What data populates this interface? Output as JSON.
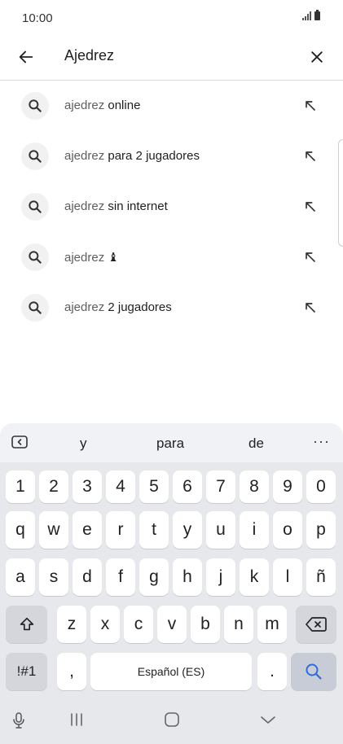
{
  "status": {
    "time": "10:00"
  },
  "search": {
    "query": "Ajedrez"
  },
  "suggestions": [
    {
      "query": "ajedrez",
      "rest": " online"
    },
    {
      "query": "ajedrez",
      "rest": " para 2 jugadores"
    },
    {
      "query": "ajedrez",
      "rest": " sin internet"
    },
    {
      "query": "ajedrez",
      "rest": " ♝"
    },
    {
      "query": "ajedrez",
      "rest": " 2 jugadores"
    }
  ],
  "keyboard": {
    "predictions": [
      "y",
      "para",
      "de"
    ],
    "more": "···",
    "row_numbers": [
      "1",
      "2",
      "3",
      "4",
      "5",
      "6",
      "7",
      "8",
      "9",
      "0"
    ],
    "row_q": [
      "q",
      "w",
      "e",
      "r",
      "t",
      "y",
      "u",
      "i",
      "o",
      "p"
    ],
    "row_a": [
      "a",
      "s",
      "d",
      "f",
      "g",
      "h",
      "j",
      "k",
      "l",
      "ñ"
    ],
    "row_z": [
      "z",
      "x",
      "c",
      "v",
      "b",
      "n",
      "m"
    ],
    "symbols": "!#1",
    "comma": ",",
    "space": "Español (ES)",
    "period": "."
  },
  "icons": {
    "back": "arrow-left-icon",
    "clear": "close-icon",
    "search": "search-icon",
    "fill": "arrow-up-left-icon",
    "shift": "shift-icon",
    "backspace": "backspace-icon",
    "mic": "microphone-icon"
  }
}
